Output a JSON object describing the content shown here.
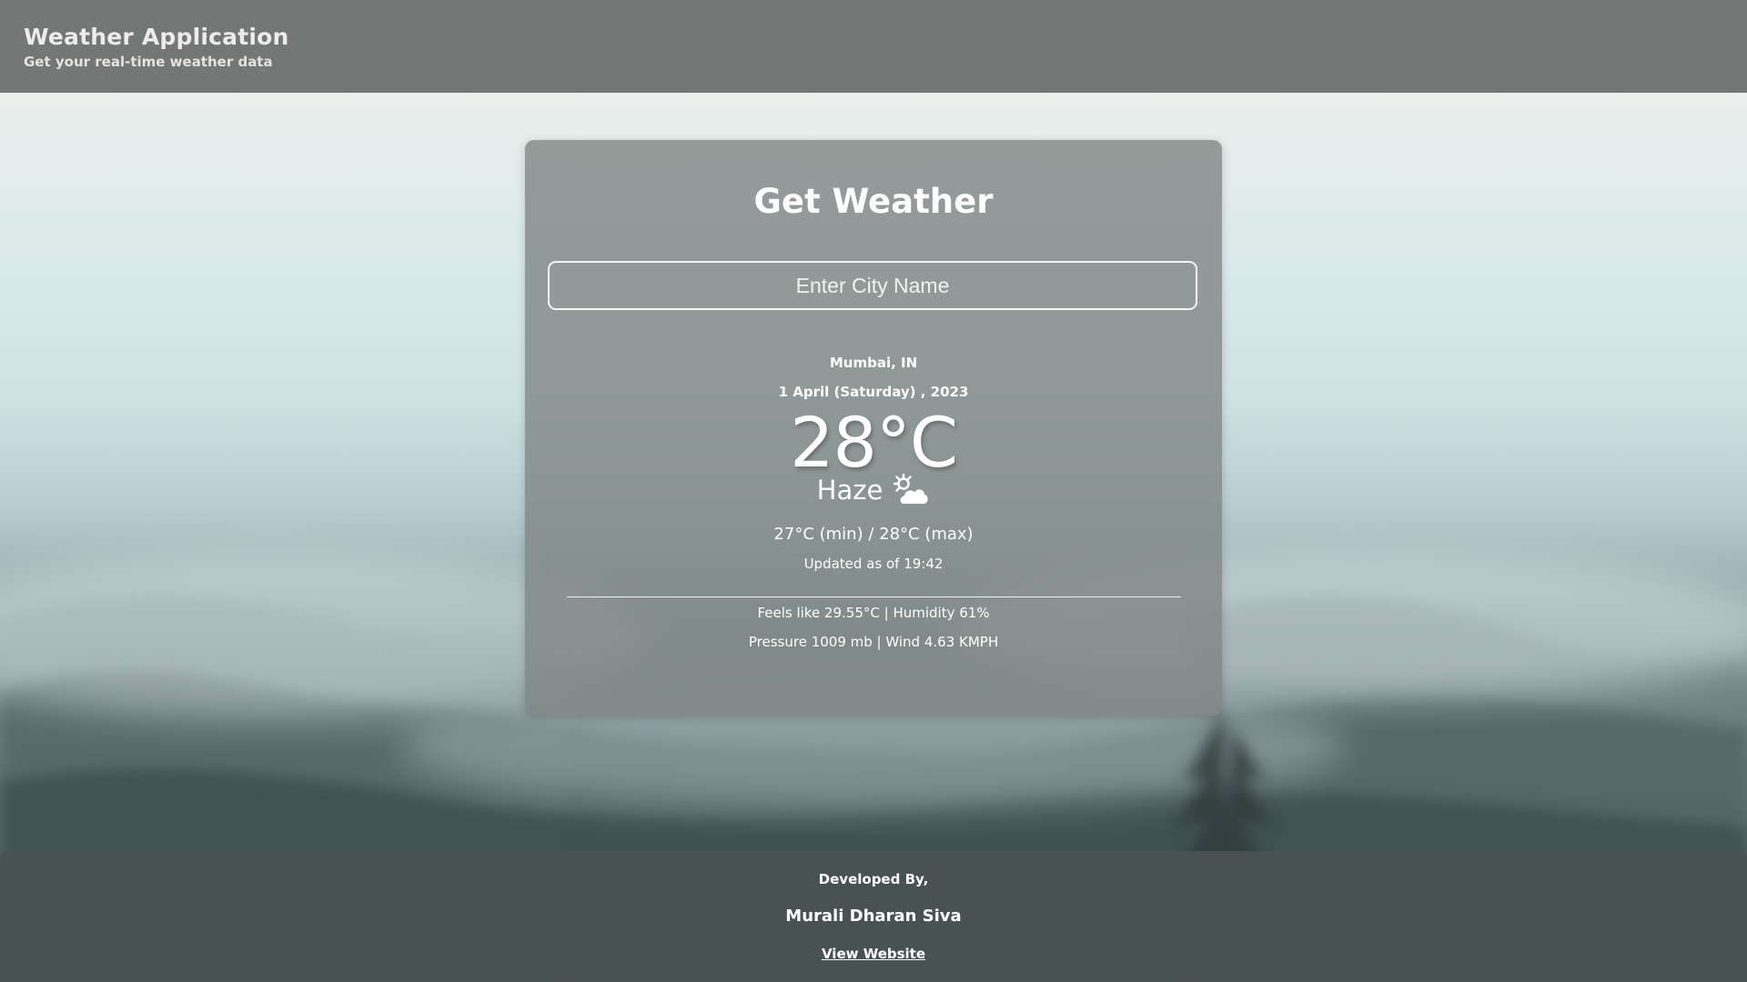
{
  "header": {
    "title": "Weather Application",
    "subtitle": "Get your real-time weather data"
  },
  "card": {
    "heading": "Get Weather",
    "search": {
      "placeholder": "Enter City Name",
      "value": ""
    },
    "location": "Mumbai, IN",
    "date": "1 April (Saturday) , 2023",
    "temperature": "28°C",
    "condition": "Haze",
    "condition_icon": "haze-sun-cloud-icon",
    "min_max": "27°C (min) / 28°C (max)",
    "updated": "Updated as of 19:42",
    "details_line1": "Feels like 29.55°C | Humidity 61%",
    "details_line2": "Pressure 1009 mb | Wind 4.63 KMPH"
  },
  "footer": {
    "developed_by": "Developed By,",
    "developer_name": "Murali Dharan Siva",
    "link_label": "View Website"
  },
  "colors": {
    "header_bg": "#696c6a",
    "card_bg": "#808684",
    "footer_bg": "#4a5252",
    "text": "#ffffff"
  }
}
